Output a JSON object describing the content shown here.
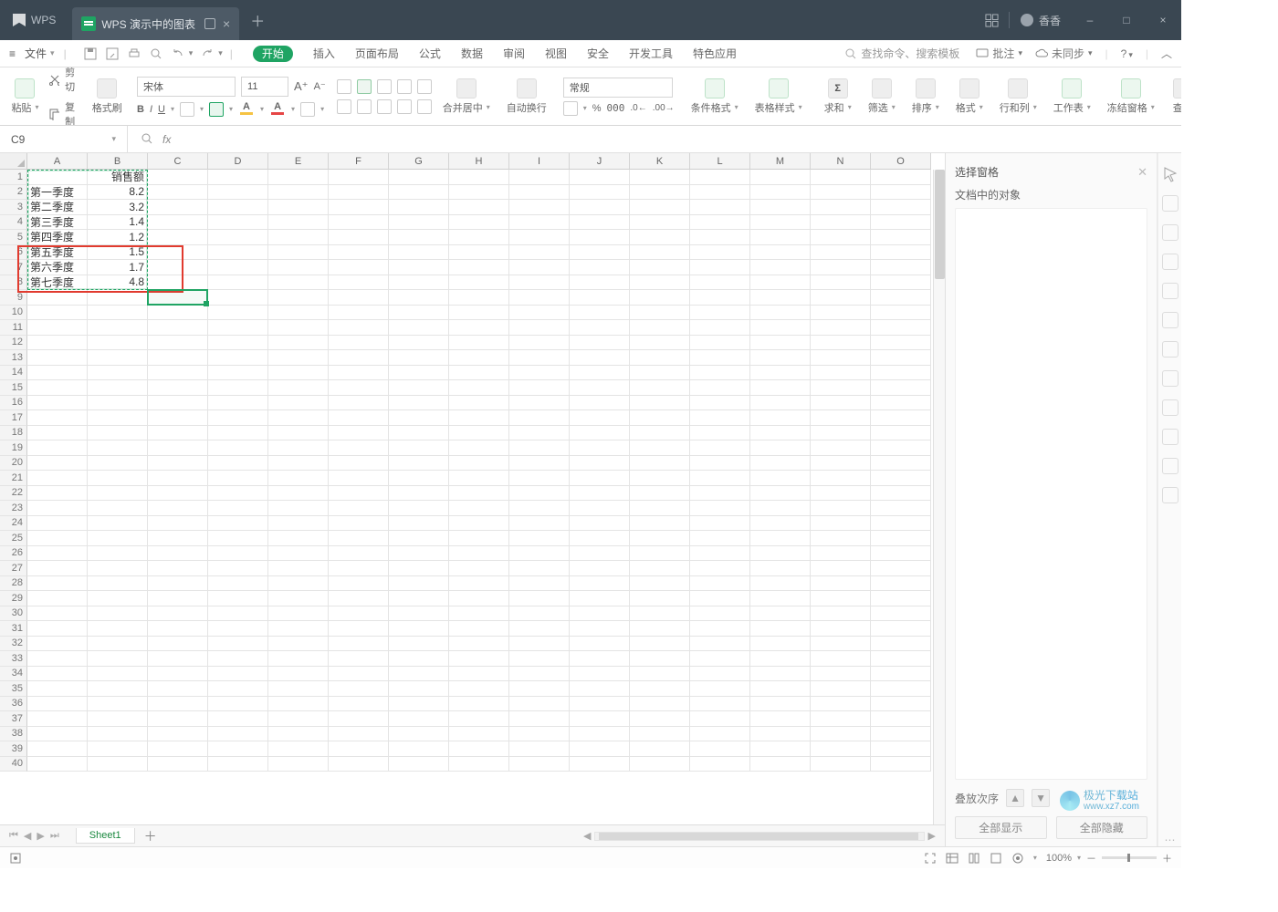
{
  "titlebar": {
    "app_name": "WPS",
    "document_tab": "WPS 演示中的图表",
    "user_name": "香香",
    "window_buttons": {
      "min": "–",
      "max": "□",
      "close": "×"
    }
  },
  "menubar": {
    "file": "文件",
    "tabs": [
      "开始",
      "插入",
      "页面布局",
      "公式",
      "数据",
      "审阅",
      "视图",
      "安全",
      "开发工具",
      "特色应用"
    ],
    "active_tab_index": 0,
    "search_placeholder": "查找命令、搜索模板",
    "annotate": "批注",
    "sync": "未同步"
  },
  "ribbon": {
    "paste": "粘贴",
    "cut": "剪切",
    "copy": "复制",
    "format_painter": "格式刷",
    "font_name": "宋体",
    "font_size": "11",
    "merge_center": "合并居中",
    "wrap_text": "自动换行",
    "number_format": "常规",
    "cond_fmt": "条件格式",
    "table_style": "表格样式",
    "sum": "求和",
    "filter": "筛选",
    "sort": "排序",
    "format": "格式",
    "rowcol": "行和列",
    "worksheet": "工作表",
    "freeze": "冻结窗格",
    "find": "查找"
  },
  "cellref": {
    "name": "C9",
    "formula": ""
  },
  "grid": {
    "columns": [
      "A",
      "B",
      "C",
      "D",
      "E",
      "F",
      "G",
      "H",
      "I",
      "J",
      "K",
      "L",
      "M",
      "N",
      "O"
    ],
    "row_count": 40,
    "data": {
      "B1": "销售额",
      "A2": "第一季度",
      "B2": "8.2",
      "A3": "第二季度",
      "B3": "3.2",
      "A4": "第三季度",
      "B4": "1.4",
      "A5": "第四季度",
      "B5": "1.2",
      "A6": "第五季度",
      "B6": "1.5",
      "A7": "第六季度",
      "B7": "1.7",
      "A8": "第七季度",
      "B8": "4.8"
    },
    "active_cell": "C9"
  },
  "side_panel": {
    "title": "选择窗格",
    "subtitle": "文档中的对象",
    "order_label": "叠放次序",
    "show_all": "全部显示",
    "hide_all": "全部隐藏"
  },
  "sheet_tabs": {
    "active": "Sheet1"
  },
  "statusbar": {
    "zoom": "100%"
  },
  "watermark": {
    "text1": "极光下载站",
    "text2": "www.xz7.com"
  }
}
